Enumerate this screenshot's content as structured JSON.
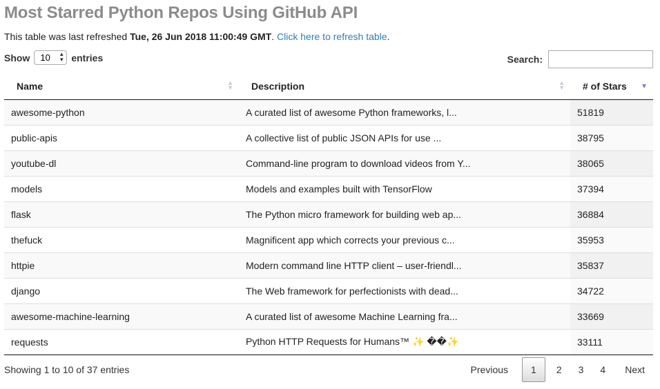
{
  "header": {
    "title": "Most Starred Python Repos Using GitHub API",
    "refresh_prefix": "This table was last refreshed ",
    "refresh_time": "Tue, 26 Jun 2018 11:00:49 GMT",
    "refresh_sep": ". ",
    "refresh_link": "Click here to refresh table",
    "refresh_suffix": "."
  },
  "length": {
    "prefix": "Show",
    "value": "10",
    "suffix": "entries"
  },
  "search": {
    "label": "Search:",
    "value": "",
    "placeholder": ""
  },
  "columns": [
    {
      "label": "Name",
      "sort": "both"
    },
    {
      "label": "Description",
      "sort": "both"
    },
    {
      "label": "# of Stars",
      "sort": "desc"
    }
  ],
  "rows": [
    {
      "name": "awesome-python",
      "description": "A curated list of awesome Python frameworks, l...",
      "stars": "51819"
    },
    {
      "name": "public-apis",
      "description": "A collective list of public JSON APIs for use ...",
      "stars": "38795"
    },
    {
      "name": "youtube-dl",
      "description": "Command-line program to download videos from Y...",
      "stars": "38065"
    },
    {
      "name": "models",
      "description": "Models and examples built with TensorFlow",
      "stars": "37394"
    },
    {
      "name": "flask",
      "description": "The Python micro framework for building web ap...",
      "stars": "36884"
    },
    {
      "name": "thefuck",
      "description": "Magnificent app which corrects your previous c...",
      "stars": "35953"
    },
    {
      "name": "httpie",
      "description": "Modern command line HTTP client – user-friendl...",
      "stars": "35837"
    },
    {
      "name": "django",
      "description": "The Web framework for perfectionists with dead...",
      "stars": "34722"
    },
    {
      "name": "awesome-machine-learning",
      "description": "A curated list of awesome Machine Learning fra...",
      "stars": "33669"
    },
    {
      "name": "requests",
      "description": "Python HTTP Requests for Humans™ ✨ ��✨",
      "stars": "33111"
    }
  ],
  "info": "Showing 1 to 10 of 37 entries",
  "pagination": {
    "previous": "Previous",
    "pages": [
      "1",
      "2",
      "3",
      "4"
    ],
    "current": "1",
    "next": "Next"
  }
}
